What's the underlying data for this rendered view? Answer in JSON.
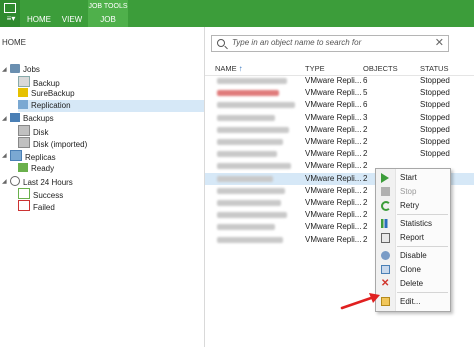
{
  "ribbon": {
    "menu_glyph": "≡▾",
    "tabs": {
      "home": "HOME",
      "view": "VIEW",
      "job_context": "JOB TOOLS",
      "job": "JOB"
    }
  },
  "nav": {
    "title": "HOME",
    "items": [
      {
        "label": "Jobs"
      },
      {
        "label": "Backup"
      },
      {
        "label": "SureBackup"
      },
      {
        "label": "Replication"
      },
      {
        "label": "Backups"
      },
      {
        "label": "Disk"
      },
      {
        "label": "Disk (imported)"
      },
      {
        "label": "Replicas"
      },
      {
        "label": "Ready"
      },
      {
        "label": "Last 24 Hours"
      },
      {
        "label": "Success"
      },
      {
        "label": "Failed"
      }
    ]
  },
  "search": {
    "placeholder": "Type in an object name to search for",
    "clear": "✕"
  },
  "table": {
    "columns": {
      "name": "NAME",
      "type": "TYPE",
      "objects": "OBJECTS",
      "status": "STATUS"
    },
    "sort_arrow": "↑",
    "rows": [
      {
        "type": "VMware Repli...",
        "objects": "6",
        "status": "Stopped"
      },
      {
        "type": "VMware Repli...",
        "objects": "5",
        "status": "Stopped"
      },
      {
        "type": "VMware Repli...",
        "objects": "6",
        "status": "Stopped"
      },
      {
        "type": "VMware Repli...",
        "objects": "3",
        "status": "Stopped"
      },
      {
        "type": "VMware Repli...",
        "objects": "2",
        "status": "Stopped"
      },
      {
        "type": "VMware Repli...",
        "objects": "2",
        "status": "Stopped"
      },
      {
        "type": "VMware Repli...",
        "objects": "2",
        "status": "Stopped"
      },
      {
        "type": "VMware Repli...",
        "objects": "2",
        "status": ""
      },
      {
        "type": "VMware Repli...",
        "objects": "2",
        "status": ""
      },
      {
        "type": "VMware Repli...",
        "objects": "2",
        "status": ""
      },
      {
        "type": "VMware Repli...",
        "objects": "2",
        "status": ""
      },
      {
        "type": "VMware Repli...",
        "objects": "2",
        "status": ""
      },
      {
        "type": "VMware Repli...",
        "objects": "2",
        "status": ""
      },
      {
        "type": "VMware Repli...",
        "objects": "2",
        "status": ""
      }
    ]
  },
  "context_menu": {
    "start": "Start",
    "stop": "Stop",
    "retry": "Retry",
    "statistics": "Statistics",
    "report": "Report",
    "disable": "Disable",
    "clone": "Clone",
    "delete": "Delete",
    "delete_glyph": "✕",
    "edit": "Edit..."
  },
  "colors": {
    "ribbon": "#3c9d3a",
    "selection": "#d6e8f7",
    "pointer": "#e02020"
  }
}
